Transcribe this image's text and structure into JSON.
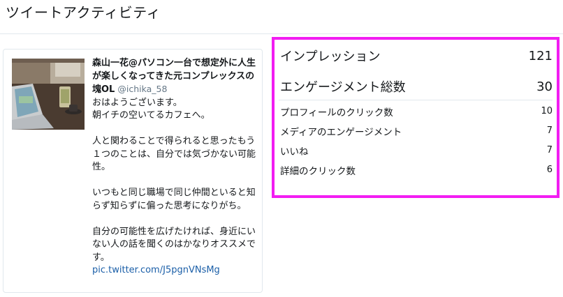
{
  "page": {
    "title": "ツイートアクティビティ"
  },
  "tweet": {
    "author_name": "森山一花@パソコン一台で想定外に人生が楽しくなってきた元コンプレックスの塊OL",
    "author_handle": "@ichika_58",
    "text": "おはようございます。\n朝イチの空いてるカフェへ。\n\n人と関わることで得られると思ったもう１つのことは、自分では気づかない可能性。\n\nいつもと同じ職場で同じ仲間といると知らず知らずに偏った思考になりがち。\n\n自分の可能性を広げたければ、身近にいない人の話を聞くのはかなりオススメです。",
    "link": "pic.twitter.com/J5pgnVNsMg"
  },
  "metrics": {
    "impressions_label": "インプレッション",
    "impressions_value": "121",
    "engagements_label": "エンゲージメント総数",
    "engagements_value": "30",
    "details": [
      {
        "label": "プロフィールのクリック数",
        "value": "10"
      },
      {
        "label": "メディアのエンゲージメント",
        "value": "7"
      },
      {
        "label": "いいね",
        "value": "7"
      },
      {
        "label": "詳細のクリック数",
        "value": "6"
      }
    ]
  },
  "colors": {
    "highlight_border": "#f21df2",
    "link": "#1b5fa8",
    "muted": "#657786"
  }
}
